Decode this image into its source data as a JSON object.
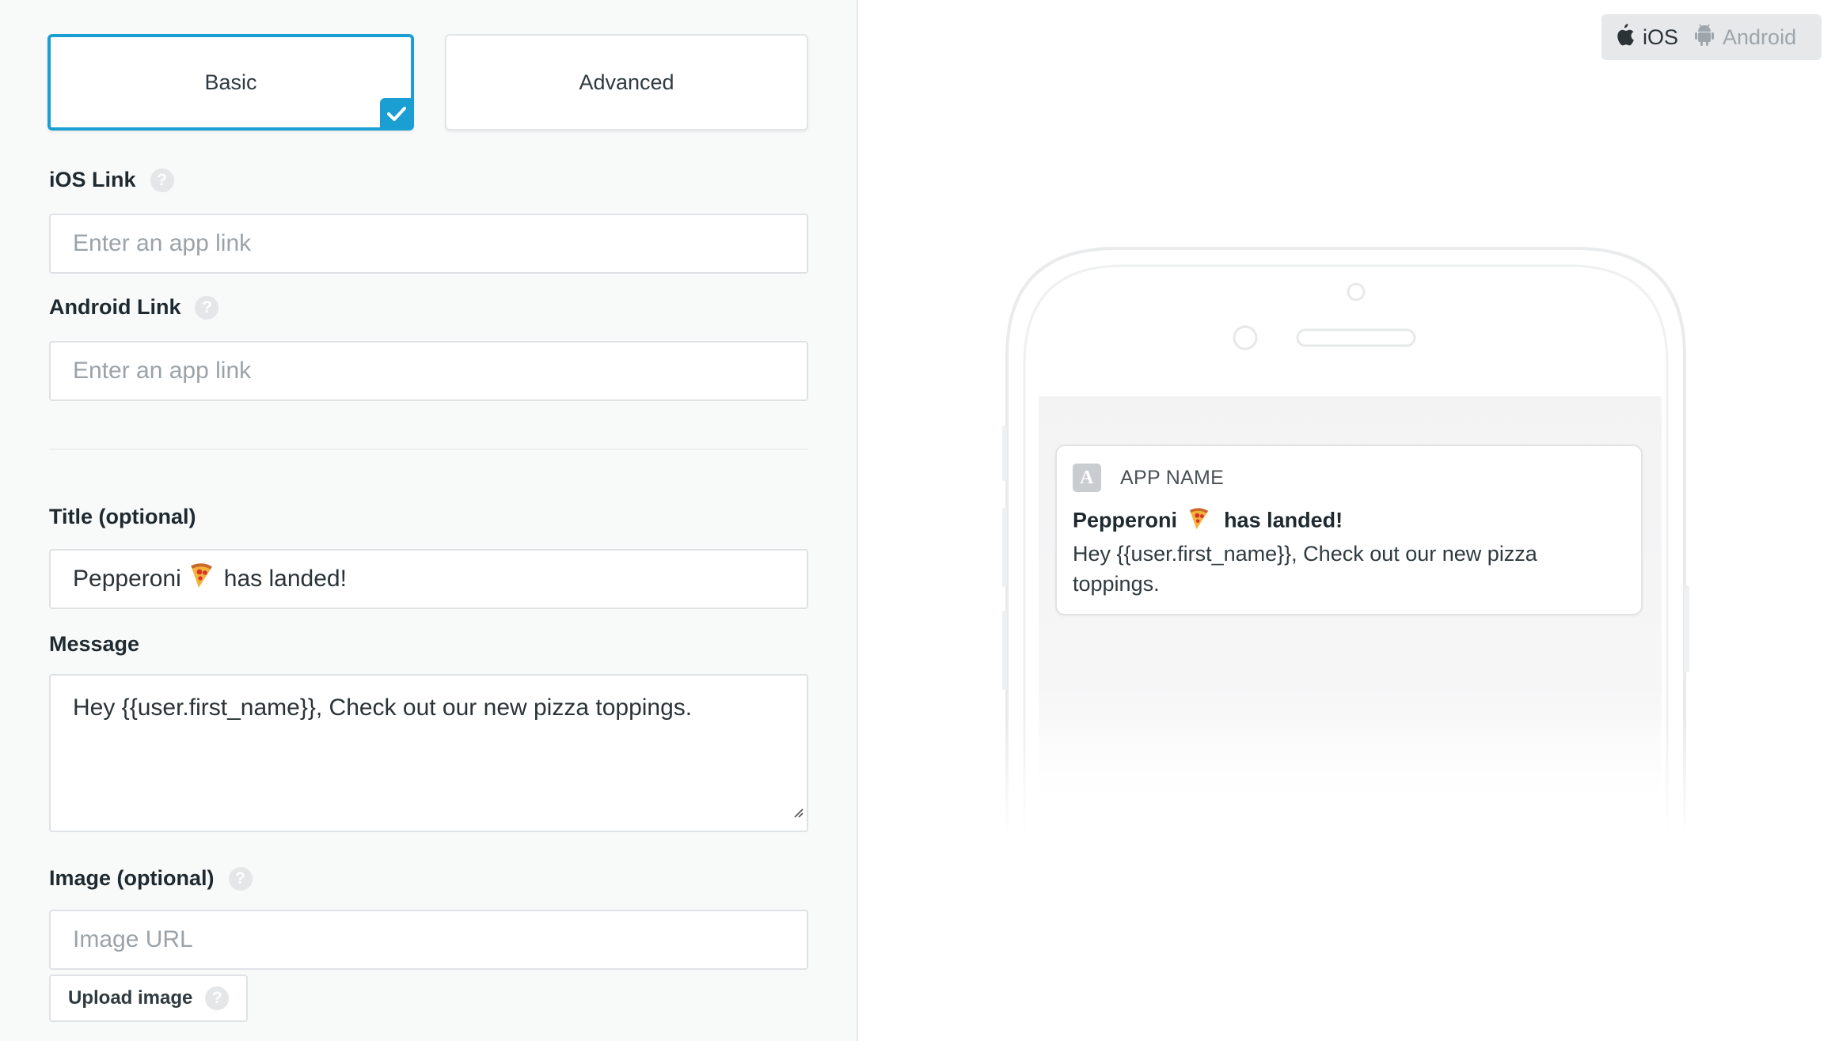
{
  "modes": {
    "basic_label": "Basic",
    "advanced_label": "Advanced",
    "selected": "Basic"
  },
  "ios_link": {
    "label": "iOS Link",
    "placeholder": "Enter an app link",
    "value": ""
  },
  "android_link": {
    "label": "Android Link",
    "placeholder": "Enter an app link",
    "value": ""
  },
  "title_field": {
    "label": "Title (optional)",
    "value_prefix": "Pepperoni",
    "value_suffix": "has landed!"
  },
  "message_field": {
    "label": "Message",
    "value": "Hey {{user.first_name}}, Check out our new pizza toppings."
  },
  "image_field": {
    "label": "Image (optional)",
    "placeholder": "Image URL",
    "value": ""
  },
  "upload": {
    "label": "Upload image"
  },
  "help_glyph": "?",
  "platform_toggle": {
    "ios_label": "iOS",
    "android_label": "Android",
    "selected": "iOS"
  },
  "preview": {
    "app_icon_letter": "A",
    "app_name": "APP NAME",
    "title_prefix": "Pepperoni",
    "title_suffix": "has landed!",
    "message": "Hey {{user.first_name}}, Check out our new pizza toppings."
  },
  "colors": {
    "accent": "#1b9fd2",
    "panel_bg": "#f8f9f9",
    "border": "#dfe2e5"
  },
  "icons": {
    "check": "check-icon",
    "help": "help-icon",
    "pizza": "pizza-icon",
    "apple": "apple-icon",
    "android": "android-icon"
  }
}
